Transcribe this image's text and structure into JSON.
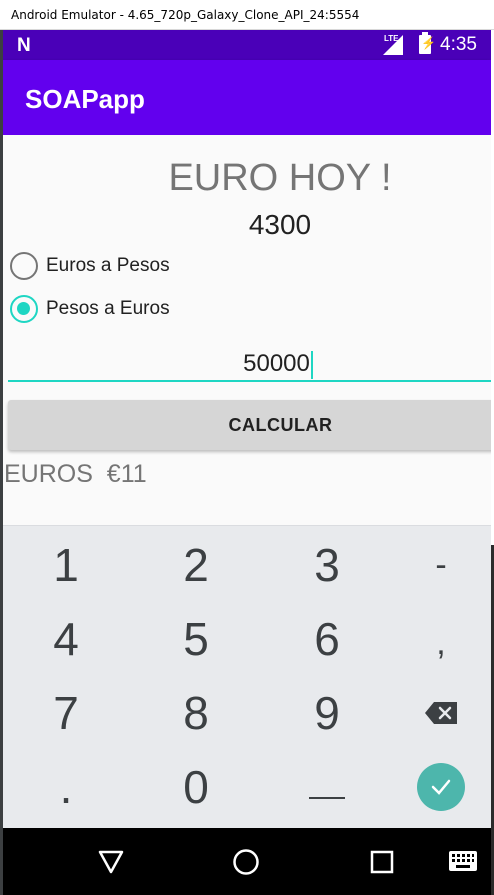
{
  "window": {
    "title": "Android Emulator - 4.65_720p_Galaxy_Clone_API_24:5554"
  },
  "statusbar": {
    "carrier_icon": "n-logo-icon",
    "network_label": "LTE",
    "time": "4:35"
  },
  "appbar": {
    "title": "SOAPapp"
  },
  "main": {
    "heading": "EURO HOY !",
    "rate": "4300",
    "options": [
      {
        "label": "Euros a Pesos",
        "checked": false
      },
      {
        "label": "Pesos a Euros",
        "checked": true
      }
    ],
    "amount_value": "50000",
    "calc_label": "CALCULAR",
    "result": "EUROS  €11"
  },
  "keyboard": {
    "rows": [
      [
        "1",
        "2",
        "3",
        "-"
      ],
      [
        "4",
        "5",
        "6",
        ","
      ],
      [
        "7",
        "8",
        "9",
        "backspace-icon"
      ],
      [
        ".",
        "0",
        "space-icon",
        "enter-check-icon"
      ]
    ]
  },
  "navbar": {
    "icons": [
      "back-triangle-icon",
      "home-circle-icon",
      "recents-square-icon",
      "keyboard-icon"
    ]
  },
  "colors": {
    "appbar": "#6200ee",
    "statusbar": "#4a00b8",
    "accent": "#1ed6c3",
    "enter": "#4db6ac"
  }
}
